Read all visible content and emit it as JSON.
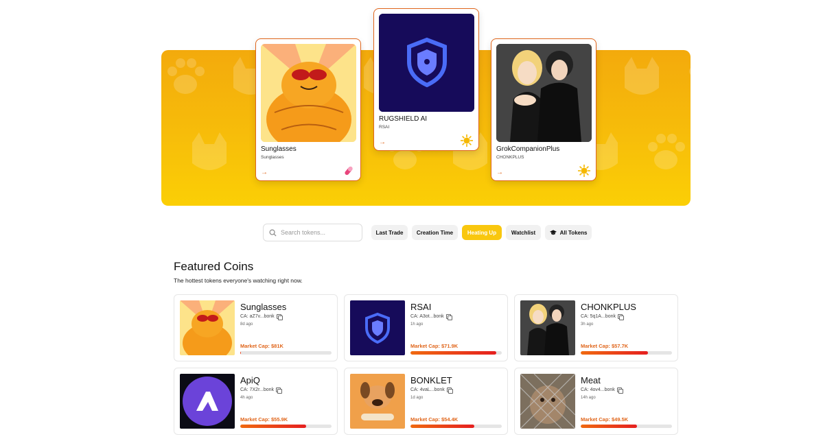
{
  "hero": {
    "featured": [
      {
        "name": "Sunglasses",
        "ticker": "Sunglasses",
        "badge": "pill-icon"
      },
      {
        "name": "RUGSHIELD AI",
        "ticker": "RSAI",
        "badge": "sun-icon"
      },
      {
        "name": "GrokCompanionPlus",
        "ticker": "CHONKPLUS",
        "badge": "sun-icon"
      }
    ],
    "arrow": "→"
  },
  "filters": {
    "search_placeholder": "Search tokens...",
    "last_trade": "Last Trade",
    "creation_time": "Creation Time",
    "heating_up": "Heating Up",
    "watchlist": "Watchlist",
    "all_tokens": "All Tokens"
  },
  "featured_section": {
    "title": "Featured Coins",
    "subtitle": "The hottest tokens everyone's watching right now."
  },
  "coins": [
    {
      "name": "Sunglasses",
      "ca": "CA: aZ7v...bonk",
      "ago": "8d ago",
      "mcap": "Market Cap: $81K",
      "progress": 0.01
    },
    {
      "name": "RSAI",
      "ca": "CA: A3ot...bonk",
      "ago": "1h ago",
      "mcap": "Market Cap: $71.9K",
      "progress": 0.94
    },
    {
      "name": "CHONKPLUS",
      "ca": "CA: 5q1A...bonk",
      "ago": "3h ago",
      "mcap": "Market Cap: $57.7K",
      "progress": 0.74
    },
    {
      "name": "ApiQ",
      "ca": "CA: 7X2r...bonk",
      "ago": "4h ago",
      "mcap": "Market Cap: $55.9K",
      "progress": 0.72
    },
    {
      "name": "BONKLET",
      "ca": "CA: 4vaL...bonk",
      "ago": "1d ago",
      "mcap": "Market Cap: $54.4K",
      "progress": 0.7
    },
    {
      "name": "Meat",
      "ca": "CA: 4ov4...bonk",
      "ago": "14h ago",
      "mcap": "Market Cap: $49.5K",
      "progress": 0.62
    }
  ],
  "colors": {
    "accent": "#e0651a",
    "active_pill": "#f9c70e",
    "hero_top": "#f3aa0c",
    "hero_bottom": "#fbcf05"
  }
}
